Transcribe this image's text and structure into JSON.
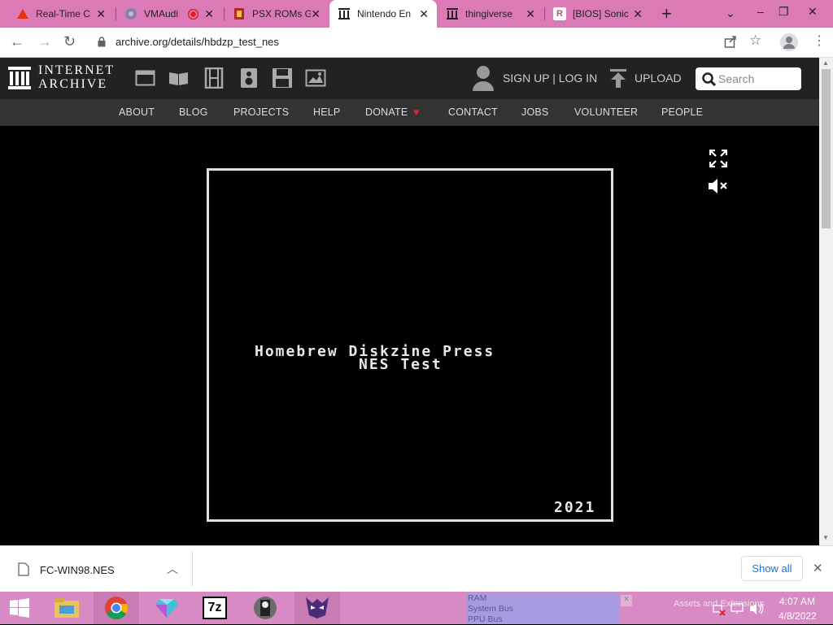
{
  "tabs": [
    {
      "label": "Real-Time C",
      "icon": "triangle-icon"
    },
    {
      "label": "VMAudi",
      "icon": "globe-icon"
    },
    {
      "label": "PSX ROMs G",
      "icon": "rom-icon"
    },
    {
      "label": "Nintendo En",
      "icon": "archive-icon",
      "active": true
    },
    {
      "label": "thingiverse",
      "icon": "archive-icon"
    },
    {
      "label": "[BIOS] Sonic",
      "icon": "r-icon"
    }
  ],
  "address": {
    "url": "archive.org/details/hbdzp_test_nes"
  },
  "ia": {
    "logo_line1": "INTERNET",
    "logo_line2": "ARCHIVE",
    "signup": "SIGN UP | LOG IN",
    "upload": "UPLOAD",
    "search_placeholder": "Search",
    "nav": [
      "ABOUT",
      "BLOG",
      "PROJECTS",
      "HELP",
      "DONATE",
      "CONTACT",
      "JOBS",
      "VOLUNTEER",
      "PEOPLE"
    ]
  },
  "game": {
    "line1": "Homebrew Diskzine Press",
    "line2": "NES Test",
    "year": "2021"
  },
  "download": {
    "filename": "FC-WIN98.NES",
    "show_all": "Show all"
  },
  "taskbar": {
    "popup_lines": [
      "RAM",
      "System Bus",
      "PPU Bus"
    ],
    "tray_text": "Assets and Extensions",
    "time": "4:07 AM",
    "date": "4/8/2022"
  },
  "colors": {
    "tabstrip": "#dc7ab8",
    "taskbar": "#d78ac4",
    "ia_header": "#222222",
    "donate_heart": "#e0262d"
  }
}
